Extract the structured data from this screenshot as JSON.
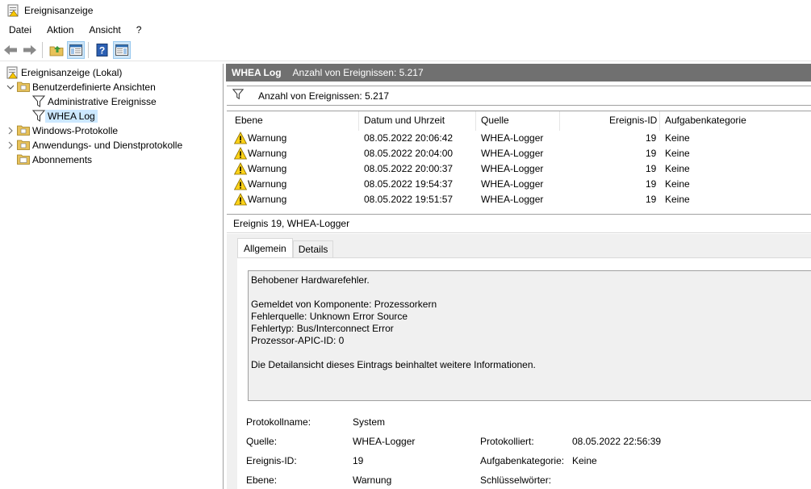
{
  "window": {
    "title": "Ereignisanzeige"
  },
  "menu": [
    "Datei",
    "Aktion",
    "Ansicht",
    "?"
  ],
  "toolbar": {
    "icons": [
      "back-arrow-icon",
      "forward-arrow-icon",
      "folder-up-icon",
      "show-hide-console-tree-icon",
      "help-icon",
      "show-hide-action-pane-icon"
    ]
  },
  "tree": {
    "root": "Ereignisanzeige (Lokal)",
    "custom_views": "Benutzerdefinierte Ansichten",
    "admin_events": "Administrative Ereignisse",
    "whea_log": "WHEA Log",
    "windows_logs": "Windows-Protokolle",
    "app_service_logs": "Anwendungs- und Dienstprotokolle",
    "subscriptions": "Abonnements"
  },
  "pane": {
    "title": "WHEA Log",
    "count_label": "Anzahl von Ereignissen: 5.217"
  },
  "filter": {
    "count_label": "Anzahl von Ereignissen: 5.217"
  },
  "grid": {
    "columns": [
      "Ebene",
      "Datum und Uhrzeit",
      "Quelle",
      "Ereignis-ID",
      "Aufgabenkategorie"
    ],
    "rows": [
      {
        "level": "Warnung",
        "datetime": "08.05.2022 20:06:42",
        "source": "WHEA-Logger",
        "id": "19",
        "category": "Keine"
      },
      {
        "level": "Warnung",
        "datetime": "08.05.2022 20:04:00",
        "source": "WHEA-Logger",
        "id": "19",
        "category": "Keine"
      },
      {
        "level": "Warnung",
        "datetime": "08.05.2022 20:00:37",
        "source": "WHEA-Logger",
        "id": "19",
        "category": "Keine"
      },
      {
        "level": "Warnung",
        "datetime": "08.05.2022 19:54:37",
        "source": "WHEA-Logger",
        "id": "19",
        "category": "Keine"
      },
      {
        "level": "Warnung",
        "datetime": "08.05.2022 19:51:57",
        "source": "WHEA-Logger",
        "id": "19",
        "category": "Keine"
      }
    ]
  },
  "detail": {
    "title": "Ereignis 19, WHEA-Logger",
    "tabs": [
      "Allgemein",
      "Details"
    ],
    "description": {
      "line1": "Behobener Hardwarefehler.",
      "line2": "Gemeldet von Komponente: Prozessorkern",
      "line3": "Fehlerquelle: Unknown Error Source",
      "line4": "Fehlertyp: Bus/Interconnect Error",
      "line5": "Prozessor-APIC-ID: 0",
      "line6": "Die Detailansicht dieses Eintrags beinhaltet weitere Informationen."
    },
    "props": {
      "log_name_label": "Protokollname:",
      "log_name_value": "System",
      "source_label": "Quelle:",
      "source_value": "WHEA-Logger",
      "logged_label": "Protokolliert:",
      "logged_value": "08.05.2022 22:56:39",
      "event_id_label": "Ereignis-ID:",
      "event_id_value": "19",
      "task_cat_label": "Aufgabenkategorie:",
      "task_cat_value": "Keine",
      "level_label": "Ebene:",
      "level_value": "Warnung",
      "keywords_label": "Schlüsselwörter:",
      "keywords_value": ""
    }
  }
}
